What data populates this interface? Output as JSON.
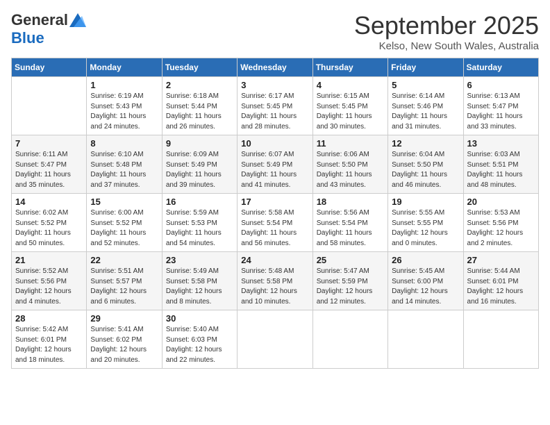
{
  "header": {
    "logo_general": "General",
    "logo_blue": "Blue",
    "month": "September 2025",
    "location": "Kelso, New South Wales, Australia"
  },
  "days_of_week": [
    "Sunday",
    "Monday",
    "Tuesday",
    "Wednesday",
    "Thursday",
    "Friday",
    "Saturday"
  ],
  "weeks": [
    [
      {
        "day": "",
        "sunrise": "",
        "sunset": "",
        "daylight": ""
      },
      {
        "day": "1",
        "sunrise": "6:19 AM",
        "sunset": "5:43 PM",
        "daylight": "11 hours and 24 minutes."
      },
      {
        "day": "2",
        "sunrise": "6:18 AM",
        "sunset": "5:44 PM",
        "daylight": "11 hours and 26 minutes."
      },
      {
        "day": "3",
        "sunrise": "6:17 AM",
        "sunset": "5:45 PM",
        "daylight": "11 hours and 28 minutes."
      },
      {
        "day": "4",
        "sunrise": "6:15 AM",
        "sunset": "5:45 PM",
        "daylight": "11 hours and 30 minutes."
      },
      {
        "day": "5",
        "sunrise": "6:14 AM",
        "sunset": "5:46 PM",
        "daylight": "11 hours and 31 minutes."
      },
      {
        "day": "6",
        "sunrise": "6:13 AM",
        "sunset": "5:47 PM",
        "daylight": "11 hours and 33 minutes."
      }
    ],
    [
      {
        "day": "7",
        "sunrise": "6:11 AM",
        "sunset": "5:47 PM",
        "daylight": "11 hours and 35 minutes."
      },
      {
        "day": "8",
        "sunrise": "6:10 AM",
        "sunset": "5:48 PM",
        "daylight": "11 hours and 37 minutes."
      },
      {
        "day": "9",
        "sunrise": "6:09 AM",
        "sunset": "5:49 PM",
        "daylight": "11 hours and 39 minutes."
      },
      {
        "day": "10",
        "sunrise": "6:07 AM",
        "sunset": "5:49 PM",
        "daylight": "11 hours and 41 minutes."
      },
      {
        "day": "11",
        "sunrise": "6:06 AM",
        "sunset": "5:50 PM",
        "daylight": "11 hours and 43 minutes."
      },
      {
        "day": "12",
        "sunrise": "6:04 AM",
        "sunset": "5:50 PM",
        "daylight": "11 hours and 46 minutes."
      },
      {
        "day": "13",
        "sunrise": "6:03 AM",
        "sunset": "5:51 PM",
        "daylight": "11 hours and 48 minutes."
      }
    ],
    [
      {
        "day": "14",
        "sunrise": "6:02 AM",
        "sunset": "5:52 PM",
        "daylight": "11 hours and 50 minutes."
      },
      {
        "day": "15",
        "sunrise": "6:00 AM",
        "sunset": "5:52 PM",
        "daylight": "11 hours and 52 minutes."
      },
      {
        "day": "16",
        "sunrise": "5:59 AM",
        "sunset": "5:53 PM",
        "daylight": "11 hours and 54 minutes."
      },
      {
        "day": "17",
        "sunrise": "5:58 AM",
        "sunset": "5:54 PM",
        "daylight": "11 hours and 56 minutes."
      },
      {
        "day": "18",
        "sunrise": "5:56 AM",
        "sunset": "5:54 PM",
        "daylight": "11 hours and 58 minutes."
      },
      {
        "day": "19",
        "sunrise": "5:55 AM",
        "sunset": "5:55 PM",
        "daylight": "12 hours and 0 minutes."
      },
      {
        "day": "20",
        "sunrise": "5:53 AM",
        "sunset": "5:56 PM",
        "daylight": "12 hours and 2 minutes."
      }
    ],
    [
      {
        "day": "21",
        "sunrise": "5:52 AM",
        "sunset": "5:56 PM",
        "daylight": "12 hours and 4 minutes."
      },
      {
        "day": "22",
        "sunrise": "5:51 AM",
        "sunset": "5:57 PM",
        "daylight": "12 hours and 6 minutes."
      },
      {
        "day": "23",
        "sunrise": "5:49 AM",
        "sunset": "5:58 PM",
        "daylight": "12 hours and 8 minutes."
      },
      {
        "day": "24",
        "sunrise": "5:48 AM",
        "sunset": "5:58 PM",
        "daylight": "12 hours and 10 minutes."
      },
      {
        "day": "25",
        "sunrise": "5:47 AM",
        "sunset": "5:59 PM",
        "daylight": "12 hours and 12 minutes."
      },
      {
        "day": "26",
        "sunrise": "5:45 AM",
        "sunset": "6:00 PM",
        "daylight": "12 hours and 14 minutes."
      },
      {
        "day": "27",
        "sunrise": "5:44 AM",
        "sunset": "6:01 PM",
        "daylight": "12 hours and 16 minutes."
      }
    ],
    [
      {
        "day": "28",
        "sunrise": "5:42 AM",
        "sunset": "6:01 PM",
        "daylight": "12 hours and 18 minutes."
      },
      {
        "day": "29",
        "sunrise": "5:41 AM",
        "sunset": "6:02 PM",
        "daylight": "12 hours and 20 minutes."
      },
      {
        "day": "30",
        "sunrise": "5:40 AM",
        "sunset": "6:03 PM",
        "daylight": "12 hours and 22 minutes."
      },
      {
        "day": "",
        "sunrise": "",
        "sunset": "",
        "daylight": ""
      },
      {
        "day": "",
        "sunrise": "",
        "sunset": "",
        "daylight": ""
      },
      {
        "day": "",
        "sunrise": "",
        "sunset": "",
        "daylight": ""
      },
      {
        "day": "",
        "sunrise": "",
        "sunset": "",
        "daylight": ""
      }
    ]
  ],
  "labels": {
    "sunrise_prefix": "Sunrise: ",
    "sunset_prefix": "Sunset: ",
    "daylight_prefix": "Daylight: "
  }
}
